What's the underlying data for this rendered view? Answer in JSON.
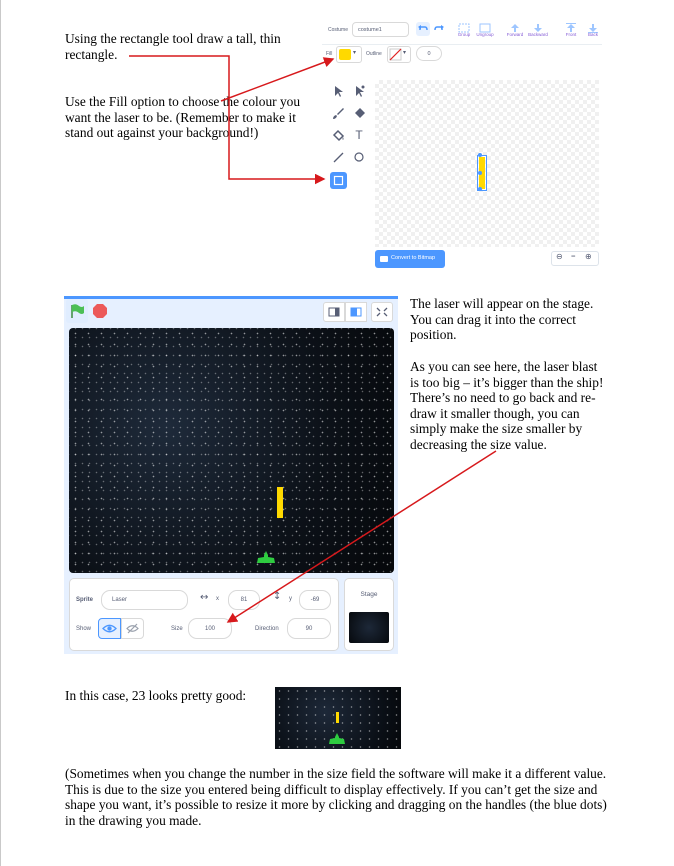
{
  "instructions": {
    "step1": "Using the rectangle tool draw a tall, thin rectangle.",
    "step2": "Use the Fill option to choose the colour you want the laser to be. (Remember to make it stand out against your background!)",
    "stage_p1": "The laser will appear on the stage. You can drag it into the correct position.",
    "stage_p2": "As you can see here, the laser blast is too big – it’s bigger than the ship! There’s no need to go back and re-draw it smaller though, you can simply make the size smaller by decreasing the size value.",
    "result": "In this case, 23 looks pretty good:",
    "note": "(Sometimes when you change the number in the size field the software will make it a different value. This is due to the size you entered being difficult to display effectively. If you can’t get the size and shape you want, it’s possible to resize it more by clicking and dragging on the handles (the blue dots) in the drawing you made."
  },
  "paint_editor": {
    "costume_label": "Costume",
    "costume_name": "costume1",
    "buttons": [
      "Group",
      "Ungroup",
      "Forward",
      "Backward",
      "Front",
      "Back"
    ],
    "fill_label": "Fill",
    "fill_color": "#ffd900",
    "outline_label": "Outline",
    "outline_width": "0",
    "convert_label": "Convert to Bitmap",
    "zoom_icons": [
      "zoom-out-icon",
      "zoom-reset-icon",
      "zoom-in-icon"
    ],
    "accent": "#4c97ff"
  },
  "stage": {
    "sprite_label": "Sprite",
    "sprite_name": "Laser",
    "x_label": "x",
    "x_value": "81",
    "y_label": "y",
    "y_value": "-69",
    "show_label": "Show",
    "size_label": "Size",
    "size_value": "100",
    "direction_label": "Direction",
    "direction_value": "90",
    "stage_label": "Stage"
  },
  "colors": {
    "arrow": "#d7191c",
    "laser": "#ffd900",
    "ship": "#2ecc40",
    "flag": "#4cbf56",
    "stop": "#ec5959"
  }
}
